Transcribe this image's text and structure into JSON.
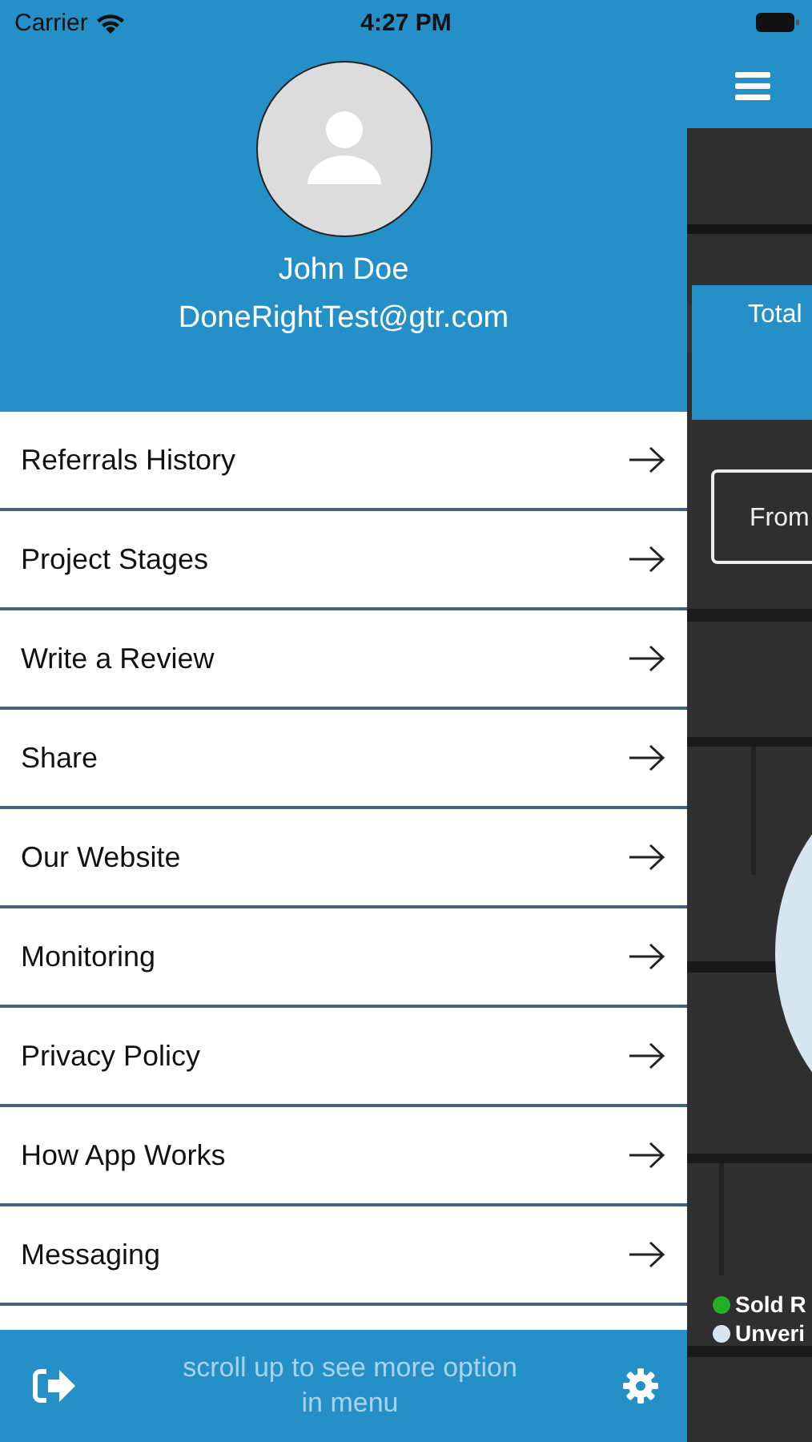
{
  "status_bar": {
    "carrier": "Carrier",
    "time": "4:27 PM"
  },
  "drawer": {
    "profile": {
      "name": "John Doe",
      "email": "DoneRightTest@gtr.com"
    },
    "menu_items": [
      {
        "label": "Referrals History"
      },
      {
        "label": "Project Stages"
      },
      {
        "label": "Write a Review"
      },
      {
        "label": "Share"
      },
      {
        "label": "Our Website"
      },
      {
        "label": "Monitoring"
      },
      {
        "label": "Privacy Policy"
      },
      {
        "label": "How App Works"
      },
      {
        "label": "Messaging"
      }
    ],
    "footer": {
      "hint": "scroll up to see more option in menu"
    }
  },
  "main": {
    "stat_card": {
      "label": "Total"
    },
    "filter": {
      "label": "From"
    },
    "legend": [
      {
        "label": "Sold R",
        "color": "#22b022"
      },
      {
        "label": "Unveri",
        "color": "#d6e6f0"
      }
    ]
  }
}
